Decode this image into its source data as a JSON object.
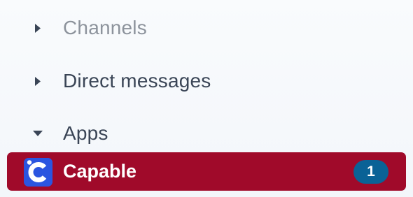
{
  "sidebar": {
    "sections": {
      "channels": {
        "label": "Channels",
        "expanded": false,
        "icon": "caret-right-icon"
      },
      "direct_messages": {
        "label": "Direct messages",
        "expanded": false,
        "icon": "caret-right-icon"
      },
      "apps": {
        "label": "Apps",
        "expanded": true,
        "icon": "caret-down-icon"
      }
    },
    "apps": [
      {
        "name": "Capable",
        "icon": "capable-app-icon",
        "unread_badge": "1",
        "selected": true
      }
    ]
  },
  "colors": {
    "selected_row": "#a00a2a",
    "badge": "#0a6296",
    "app_icon": "#2b55e0",
    "muted_text": "#8d939c",
    "text": "#3a4556"
  }
}
